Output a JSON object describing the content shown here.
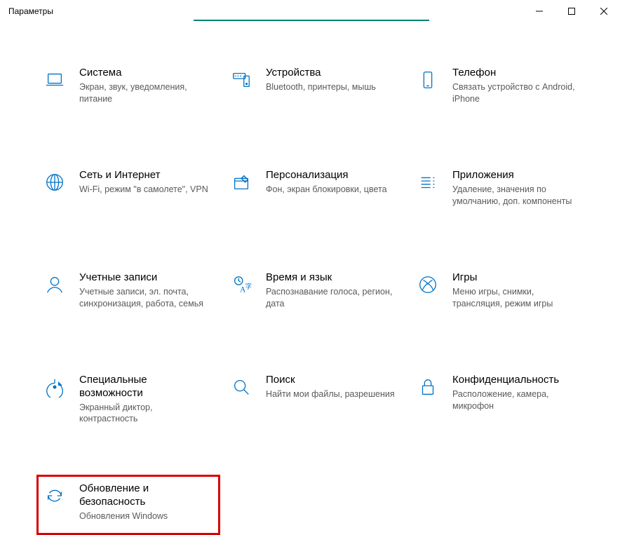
{
  "window": {
    "title": "Параметры"
  },
  "tiles": [
    {
      "id": "system",
      "title": "Система",
      "desc": "Экран, звук, уведомления, питание"
    },
    {
      "id": "devices",
      "title": "Устройства",
      "desc": "Bluetooth, принтеры, мышь"
    },
    {
      "id": "phone",
      "title": "Телефон",
      "desc": "Связать устройство с Android, iPhone"
    },
    {
      "id": "network",
      "title": "Сеть и Интернет",
      "desc": "Wi-Fi, режим \"в самолете\", VPN"
    },
    {
      "id": "personalization",
      "title": "Персонализация",
      "desc": "Фон, экран блокировки, цвета"
    },
    {
      "id": "apps",
      "title": "Приложения",
      "desc": "Удаление, значения по умолчанию, доп. компоненты"
    },
    {
      "id": "accounts",
      "title": "Учетные записи",
      "desc": "Учетные записи, эл. почта, синхронизация, работа, семья"
    },
    {
      "id": "time",
      "title": "Время и язык",
      "desc": "Распознавание голоса, регион, дата"
    },
    {
      "id": "gaming",
      "title": "Игры",
      "desc": "Меню игры, снимки, трансляция, режим игры"
    },
    {
      "id": "accessibility",
      "title": "Специальные возможности",
      "desc": "Экранный диктор, контрастность"
    },
    {
      "id": "search",
      "title": "Поиск",
      "desc": "Найти мои файлы, разрешения"
    },
    {
      "id": "privacy",
      "title": "Конфиденциальность",
      "desc": "Расположение, камера, микрофон"
    },
    {
      "id": "update",
      "title": "Обновление и безопасность",
      "desc": "Обновления Windows"
    }
  ],
  "highlighted_tile": "update"
}
